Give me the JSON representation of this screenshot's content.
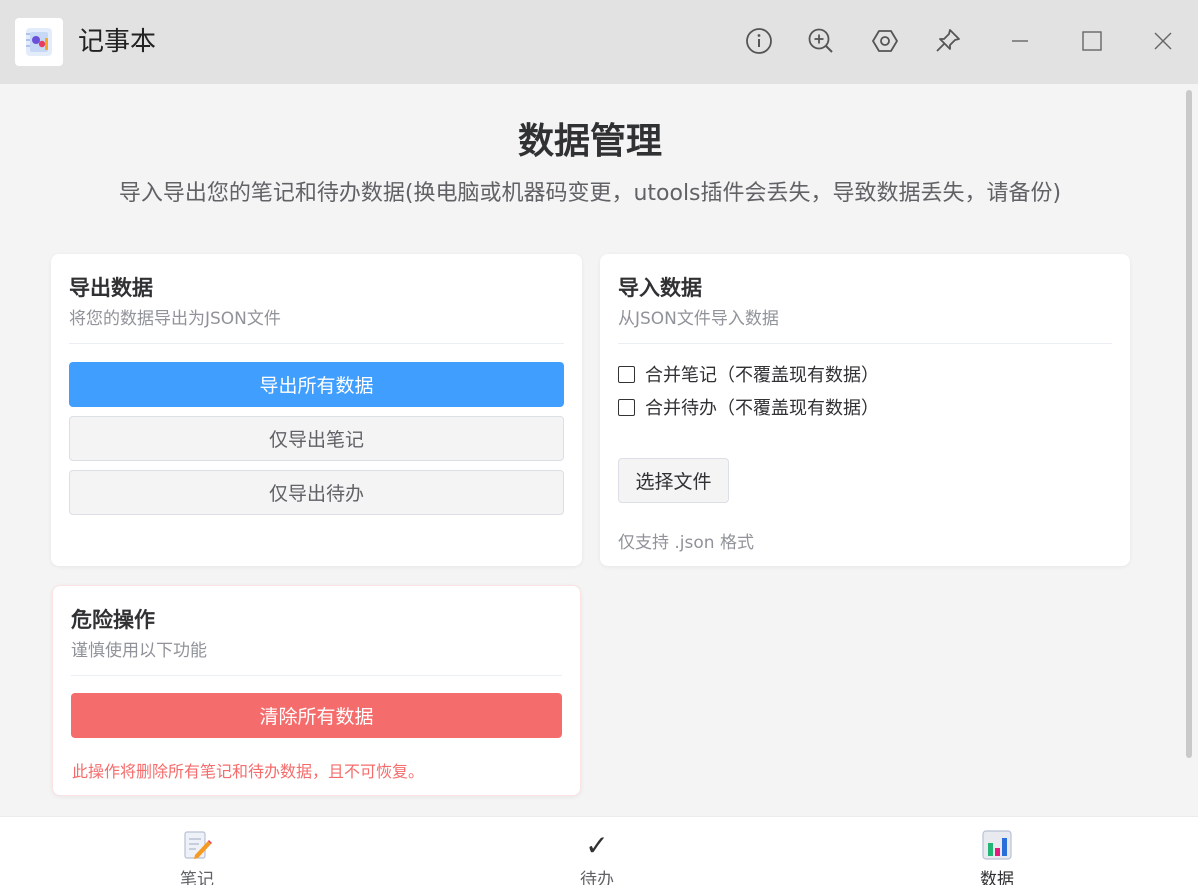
{
  "titlebar": {
    "app_title": "记事本",
    "icons": [
      "info-icon",
      "zoom-in-icon",
      "settings-icon",
      "pin-icon",
      "minimize-icon",
      "maximize-icon",
      "close-icon"
    ]
  },
  "header": {
    "title": "数据管理",
    "subtitle": "导入导出您的笔记和待办数据(换电脑或机器码变更，utools插件会丢失，导致数据丢失，请备份)"
  },
  "export_card": {
    "title": "导出数据",
    "desc": "将您的数据导出为JSON文件",
    "export_all": "导出所有数据",
    "export_notes": "仅导出笔记",
    "export_todos": "仅导出待办"
  },
  "import_card": {
    "title": "导入数据",
    "desc": "从JSON文件导入数据",
    "merge_notes": "合并笔记（不覆盖现有数据）",
    "merge_todos": "合并待办（不覆盖现有数据）",
    "select_file": "选择文件",
    "hint": "仅支持 .json 格式"
  },
  "danger_card": {
    "title": "危险操作",
    "desc": "谨慎使用以下功能",
    "clear_all": "清除所有数据",
    "warning": "此操作将删除所有笔记和待办数据，且不可恢复。"
  },
  "bottom_nav": {
    "notes": "笔记",
    "todos": "待办",
    "data": "数据",
    "todo_icon_glyph": "✓"
  },
  "colors": {
    "primary": "#409eff",
    "danger": "#f56c6c",
    "background": "#f4f4f4",
    "titlebar": "#e2e2e2"
  }
}
